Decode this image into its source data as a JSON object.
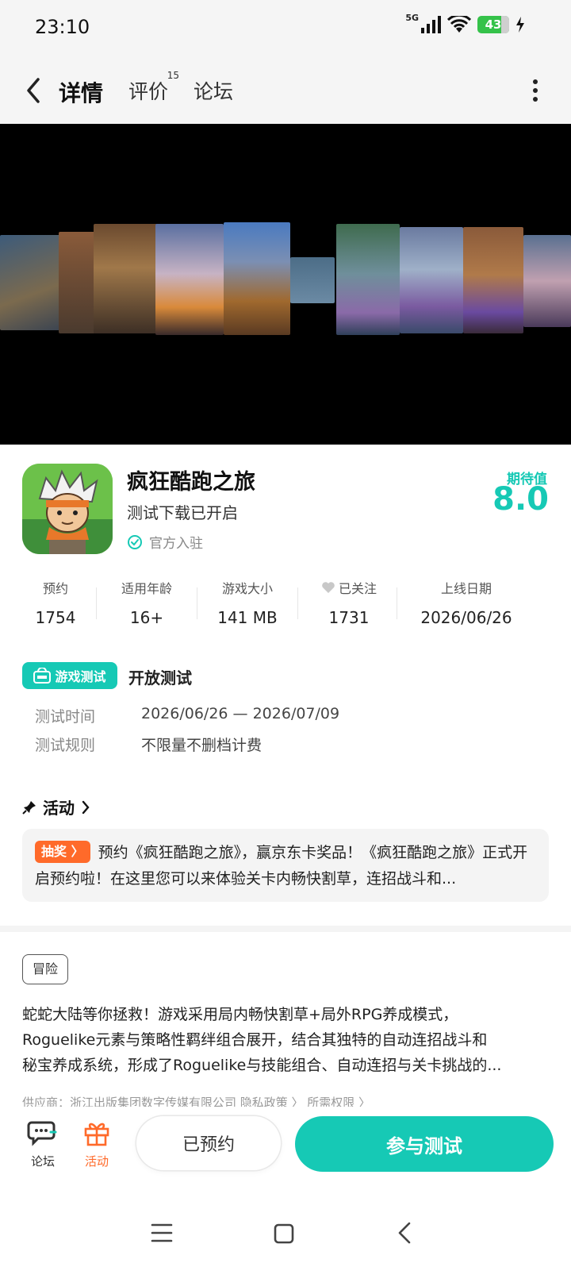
{
  "status_bar": {
    "time": "23:10",
    "network": "5G",
    "battery": "43"
  },
  "nav": {
    "tab_detail": "详情",
    "tab_review": "评价",
    "review_count": "15",
    "tab_forum": "论坛"
  },
  "app": {
    "title": "疯狂酷跑之旅",
    "subtitle": "测试下载已开启",
    "official": "官方入驻",
    "expect_label": "期待值",
    "expect_score": "8.0"
  },
  "stats": [
    {
      "label": "预约",
      "value": "1754"
    },
    {
      "label": "适用年龄",
      "value": "16+"
    },
    {
      "label": "游戏大小",
      "value": "141 MB"
    },
    {
      "label": "已关注",
      "value": "1731"
    },
    {
      "label": "上线日期",
      "value": "2026/06/26"
    }
  ],
  "test": {
    "badge": "游戏测试",
    "type": "开放测试",
    "time_label": "测试时间",
    "time_value": "2026/06/26 — 2026/07/09",
    "rule_label": "测试规则",
    "rule_value": "不限量不删档计费"
  },
  "activity": {
    "heading": "活动",
    "tag": "抽奖",
    "text": "预约《疯狂酷跑之旅》，赢京东卡奖品！《疯狂酷跑之旅》正式开启预约啦！在这里您可以来体验关卡内畅快割草，连招战斗和..."
  },
  "about": {
    "genre": "冒险",
    "desc_l1": "蛇蛇大陆等你拯救！游戏采用局内畅快割草+局外RPG养成模式，",
    "desc_l2": "Roguelike元素与策略性羁绊组合展开，结合其独特的自动连招战斗和",
    "desc_l3": "秘宝养成系统，形成了Roguelike与技能组合、自动连招与关卡挑战的...",
    "supplier": "供应商：浙江出版集团数字传媒有限公司    隐私政策 〉    所需权限 〉"
  },
  "bottom": {
    "forum": "论坛",
    "activity": "活动",
    "reserved": "已预约",
    "join": "参与测试"
  },
  "colors": {
    "accent": "#16c9b5",
    "orange": "#ff6a2a"
  }
}
